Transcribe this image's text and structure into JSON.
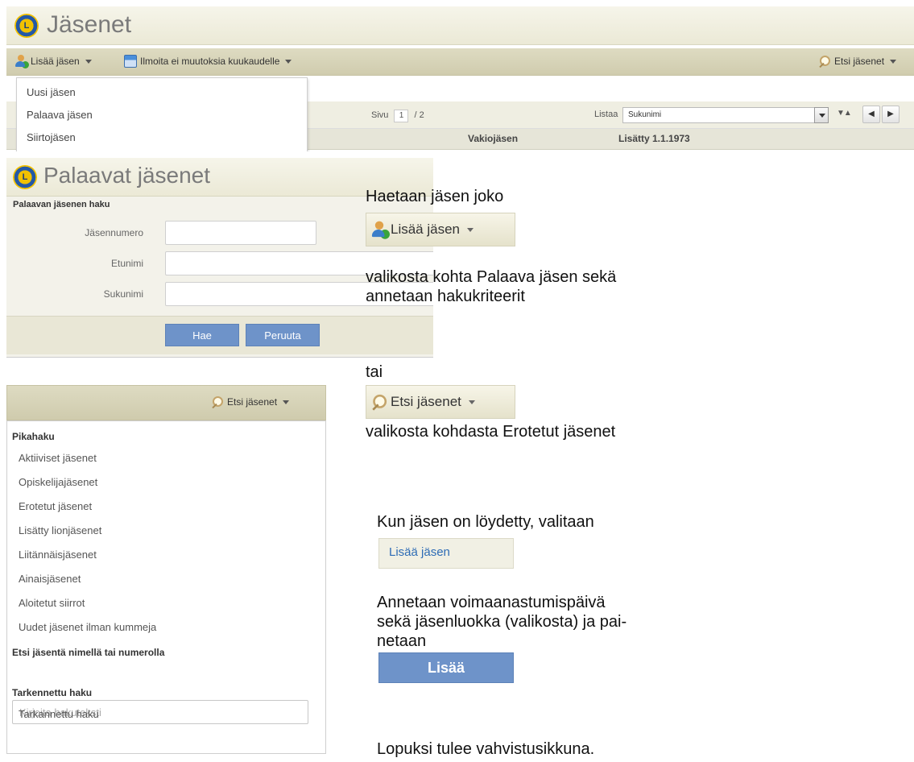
{
  "shot1": {
    "title": "Jäsenet",
    "toolbar": {
      "add_member": "Lisää jäsen",
      "report_no_changes": "Ilmoita ei muutoksia kuukaudelle",
      "search_members": "Etsi jäsenet"
    },
    "add_menu": [
      "Uusi jäsen",
      "Palaava jäsen",
      "Siirtojäsen"
    ],
    "pager": {
      "page_label": "Sivu",
      "page_value": "1",
      "page_total": "/ 2",
      "list_label": "Listaa",
      "list_value": "Sukunimi"
    },
    "headers": {
      "col1": "Vakiojäsen",
      "col2": "Lisätty 1.1.1973"
    }
  },
  "shot2": {
    "title": "Palaavat jäsenet",
    "section": "Palaavan jäsenen haku",
    "labels": {
      "member_number": "Jäsennumero",
      "first_name": "Etunimi",
      "last_name": "Sukunimi"
    },
    "buttons": {
      "search": "Hae",
      "cancel": "Peruuta"
    }
  },
  "shot3": {
    "search_button": "Etsi jäsenet",
    "quick_heading": "Pikahaku",
    "quick_items": [
      "Aktiiviset jäsenet",
      "Opiskelijajäsenet",
      "Erotetut jäsenet",
      "Lisätty lionjäsenet",
      "Liitännäisjäsenet",
      "Ainaisjäsenet",
      "Aloitetut siirrot",
      "Uudet jäsenet ilman kummeja"
    ],
    "name_heading": "Etsi jäsentä nimellä tai numerolla",
    "name_placeholder": "Kirjoita hakuteksti",
    "advanced_heading": "Tarkennettu haku",
    "advanced_item": "Tarkannettu haku"
  },
  "instructions": {
    "p1": "Haetaan jäsen joko",
    "btn_add": "Lisää jäsen",
    "p2a": "valikosta kohta Palaava jäsen sekä",
    "p2b": "annetaan hakukriteerit",
    "p3": "tai",
    "btn_search": "Etsi jäsenet",
    "p4": "valikosta kohdasta Erotetut jäsenet",
    "p5": "Kun jäsen on löydetty, valitaan",
    "btn_add_flat": "Lisää jäsen",
    "p6a": "Annetaan voimaanastumispäivä",
    "p6b": "sekä jäsenluokka (valikosta) ja pai-",
    "p6c": "netaan",
    "btn_lisaa": "Lisää",
    "p7": "Lopuksi tulee vahvistusikkuna."
  }
}
